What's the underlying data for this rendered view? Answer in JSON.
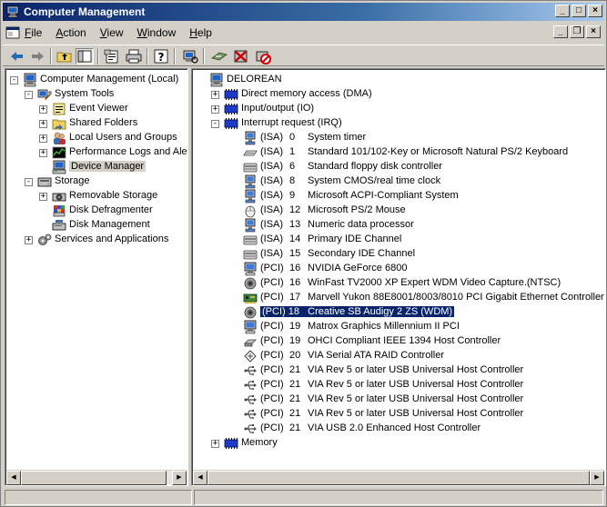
{
  "window": {
    "title": "Computer Management"
  },
  "menu": [
    {
      "label": "File",
      "u": "F",
      "rest": "ile"
    },
    {
      "label": "Action",
      "u": "A",
      "rest": "ction"
    },
    {
      "label": "View",
      "u": "V",
      "rest": "iew"
    },
    {
      "label": "Window",
      "u": "W",
      "rest": "indow"
    },
    {
      "label": "Help",
      "u": "H",
      "rest": "elp"
    }
  ],
  "toolbar_icons": [
    "back-arrow-icon",
    "forward-arrow-icon",
    "up-folder-icon",
    "show-hide-tree-icon",
    "properties-icon",
    "print-icon",
    "help-icon",
    "scan-hardware-icon",
    "update-driver-icon",
    "uninstall-icon",
    "disable-device-icon"
  ],
  "left_tree": [
    {
      "label": "Computer Management (Local)",
      "depth": 0,
      "exp": "-",
      "icon": "computer-management-icon",
      "name": "tree-computer-management"
    },
    {
      "label": "System Tools",
      "depth": 1,
      "exp": "-",
      "icon": "system-tools-icon",
      "name": "tree-system-tools"
    },
    {
      "label": "Event Viewer",
      "depth": 2,
      "exp": "+",
      "icon": "event-viewer-icon",
      "name": "tree-event-viewer"
    },
    {
      "label": "Shared Folders",
      "depth": 2,
      "exp": "+",
      "icon": "shared-folders-icon",
      "name": "tree-shared-folders"
    },
    {
      "label": "Local Users and Groups",
      "depth": 2,
      "exp": "+",
      "icon": "users-icon",
      "name": "tree-local-users"
    },
    {
      "label": "Performance Logs and Alerts",
      "depth": 2,
      "exp": "+",
      "icon": "performance-icon",
      "name": "tree-performance-logs"
    },
    {
      "label": "Device Manager",
      "depth": 2,
      "exp": "",
      "icon": "device-manager-icon",
      "name": "tree-device-manager",
      "state": "hl"
    },
    {
      "label": "Storage",
      "depth": 1,
      "exp": "-",
      "icon": "storage-icon",
      "name": "tree-storage"
    },
    {
      "label": "Removable Storage",
      "depth": 2,
      "exp": "+",
      "icon": "removable-storage-icon",
      "name": "tree-removable-storage"
    },
    {
      "label": "Disk Defragmenter",
      "depth": 2,
      "exp": "",
      "icon": "defragmenter-icon",
      "name": "tree-disk-defragmenter"
    },
    {
      "label": "Disk Management",
      "depth": 2,
      "exp": "",
      "icon": "disk-management-icon",
      "name": "tree-disk-management"
    },
    {
      "label": "Services and Applications",
      "depth": 1,
      "exp": "+",
      "icon": "services-icon",
      "name": "tree-services-applications"
    }
  ],
  "right_tree": {
    "root": {
      "label": "DELOREAN",
      "icon": "computer-icon"
    },
    "categories": [
      {
        "label": "Direct memory access (DMA)",
        "exp": "+",
        "icon": "dma-icon"
      },
      {
        "label": "Input/output (IO)",
        "exp": "+",
        "icon": "io-icon"
      },
      {
        "label": "Interrupt request (IRQ)",
        "exp": "-",
        "icon": "irq-icon"
      }
    ],
    "irq_items": [
      {
        "bus": "(ISA)",
        "num": "0",
        "label": "System timer",
        "icon": "system-device-icon"
      },
      {
        "bus": "(ISA)",
        "num": "1",
        "label": "Standard 101/102-Key or Microsoft Natural PS/2 Keyboard",
        "icon": "keyboard-icon"
      },
      {
        "bus": "(ISA)",
        "num": "6",
        "label": "Standard floppy disk controller",
        "icon": "floppy-controller-icon"
      },
      {
        "bus": "(ISA)",
        "num": "8",
        "label": "System CMOS/real time clock",
        "icon": "system-device-icon"
      },
      {
        "bus": "(ISA)",
        "num": "9",
        "label": "Microsoft ACPI-Compliant System",
        "icon": "system-device-icon"
      },
      {
        "bus": "(ISA)",
        "num": "12",
        "label": "Microsoft PS/2 Mouse",
        "icon": "mouse-icon"
      },
      {
        "bus": "(ISA)",
        "num": "13",
        "label": "Numeric data processor",
        "icon": "system-device-icon"
      },
      {
        "bus": "(ISA)",
        "num": "14",
        "label": "Primary IDE Channel",
        "icon": "ide-controller-icon"
      },
      {
        "bus": "(ISA)",
        "num": "15",
        "label": "Secondary IDE Channel",
        "icon": "ide-controller-icon"
      },
      {
        "bus": "(PCI)",
        "num": "16",
        "label": "NVIDIA GeForce 6800",
        "icon": "display-adapter-icon"
      },
      {
        "bus": "(PCI)",
        "num": "16",
        "label": "WinFast TV2000 XP Expert WDM Video Capture.(NTSC)",
        "icon": "sound-video-icon"
      },
      {
        "bus": "(PCI)",
        "num": "17",
        "label": "Marvell Yukon 88E8001/8003/8010 PCI Gigabit Ethernet Controller",
        "icon": "network-adapter-icon"
      },
      {
        "bus": "(PCI)",
        "num": "18",
        "label": "Creative SB Audigy 2 ZS (WDM)",
        "icon": "sound-video-icon",
        "selected": true
      },
      {
        "bus": "(PCI)",
        "num": "19",
        "label": "Matrox Graphics Millennium II PCI",
        "icon": "display-adapter-icon"
      },
      {
        "bus": "(PCI)",
        "num": "19",
        "label": "OHCI Compliant IEEE 1394 Host Controller",
        "icon": "firewire-icon"
      },
      {
        "bus": "(PCI)",
        "num": "20",
        "label": "VIA Serial ATA RAID Controller",
        "icon": "raid-controller-icon"
      },
      {
        "bus": "(PCI)",
        "num": "21",
        "label": "VIA Rev 5 or later USB Universal Host Controller",
        "icon": "usb-icon"
      },
      {
        "bus": "(PCI)",
        "num": "21",
        "label": "VIA Rev 5 or later USB Universal Host Controller",
        "icon": "usb-icon"
      },
      {
        "bus": "(PCI)",
        "num": "21",
        "label": "VIA Rev 5 or later USB Universal Host Controller",
        "icon": "usb-icon"
      },
      {
        "bus": "(PCI)",
        "num": "21",
        "label": "VIA Rev 5 or later USB Universal Host Controller",
        "icon": "usb-icon"
      },
      {
        "bus": "(PCI)",
        "num": "21",
        "label": "VIA USB 2.0 Enhanced Host Controller",
        "icon": "usb-icon"
      }
    ],
    "tail": {
      "label": "Memory",
      "exp": "+",
      "icon": "memory-icon"
    }
  }
}
